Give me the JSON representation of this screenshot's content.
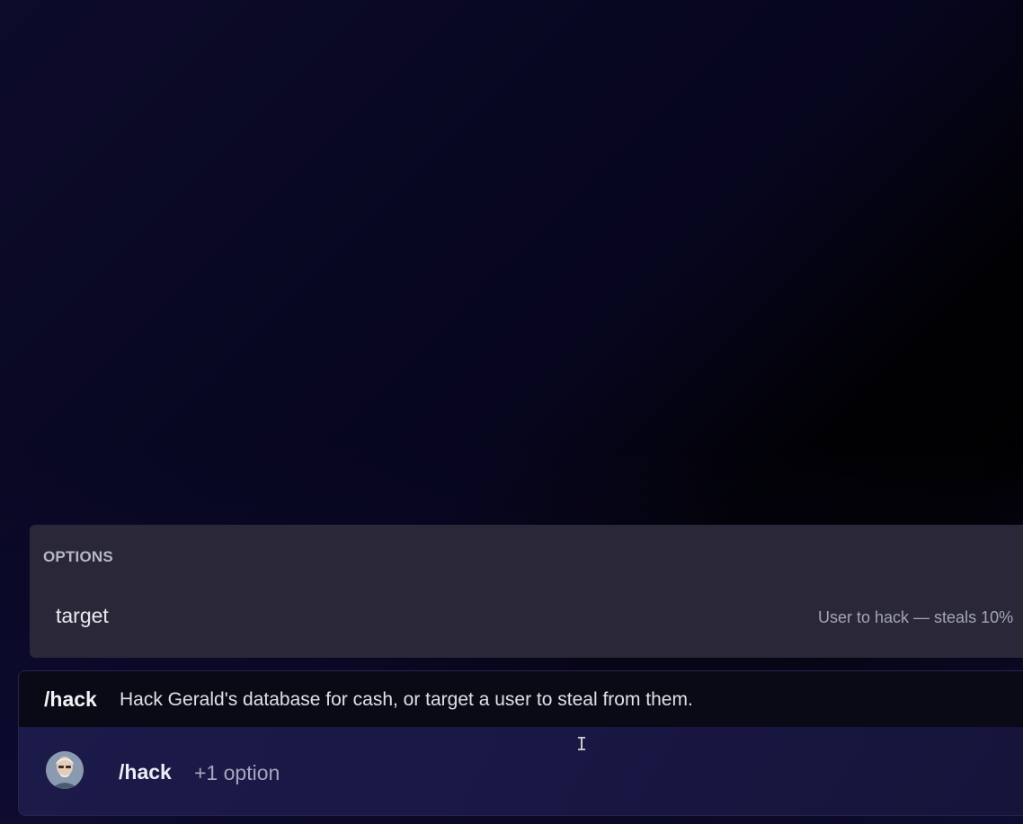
{
  "options": {
    "header": "OPTIONS",
    "items": [
      {
        "name": "target",
        "description": "User to hack — steals 10%"
      }
    ]
  },
  "command": {
    "name": "/hack",
    "description": "Hack Gerald's database for cash, or target a user to steal from them."
  },
  "input": {
    "command": "/hack",
    "option_hint": "+1 option"
  },
  "icons": {
    "avatar": "user-avatar",
    "cursor": "text-cursor-icon"
  }
}
